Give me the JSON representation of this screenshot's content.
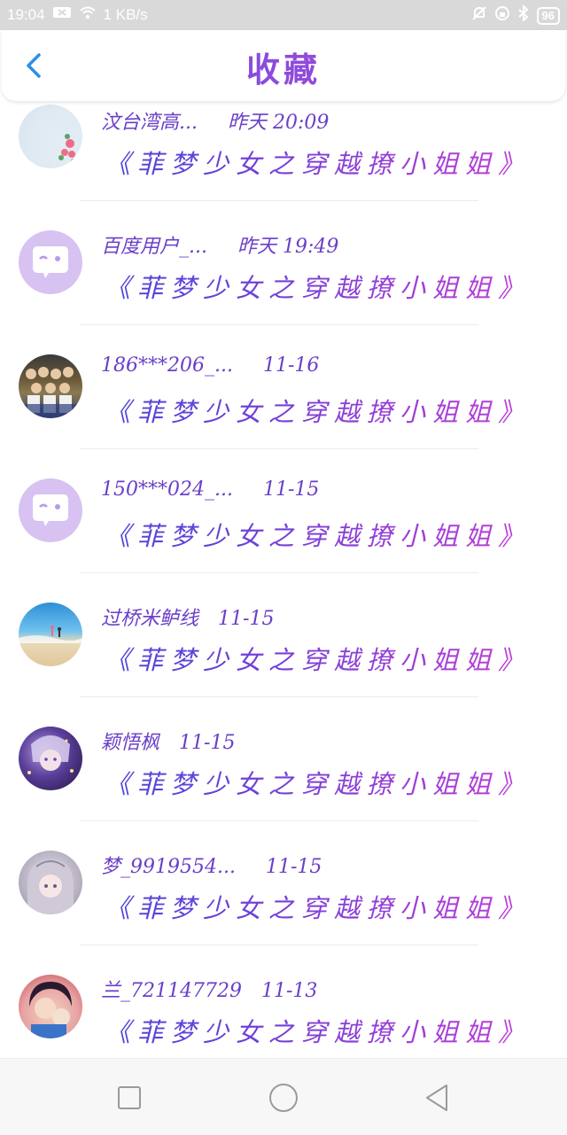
{
  "status": {
    "time": "19:04",
    "speed": "1 KB/s",
    "battery": "96"
  },
  "header": {
    "title": "收藏"
  },
  "items": [
    {
      "user": "汶台湾高...",
      "time": "昨天 20:09",
      "book": "《菲梦少女之穿越撩小姐姐》",
      "avatar": "flower-avatar"
    },
    {
      "user": "百度用户_...",
      "time": "昨天 19:49",
      "book": "《菲梦少女之穿越撩小姐姐》",
      "avatar": "bubble-avatar"
    },
    {
      "user": "186***206_...",
      "time": "11-16",
      "book": "《菲梦少女之穿越撩小姐姐》",
      "avatar": "group-photo-avatar"
    },
    {
      "user": "150***024_...",
      "time": "11-15",
      "book": "《菲梦少女之穿越撩小姐姐》",
      "avatar": "bubble-avatar"
    },
    {
      "user": "过桥米鲈线",
      "time": "11-15",
      "book": "《菲梦少女之穿越撩小姐姐》",
      "avatar": "beach-avatar"
    },
    {
      "user": "颖悟枫",
      "time": "11-15",
      "book": "《菲梦少女之穿越撩小姐姐》",
      "avatar": "anime-avatar"
    },
    {
      "user": "梦_9919554...",
      "time": "11-15",
      "book": "《菲梦少女之穿越撩小姐姐》",
      "avatar": "anime-girl-avatar"
    },
    {
      "user": "兰_721147729",
      "time": "11-13",
      "book": "《菲梦少女之穿越撩小姐姐》",
      "avatar": "ran-avatar"
    }
  ],
  "colors": {
    "accent": "#7a3fd6",
    "back": "#2a8fe8"
  }
}
